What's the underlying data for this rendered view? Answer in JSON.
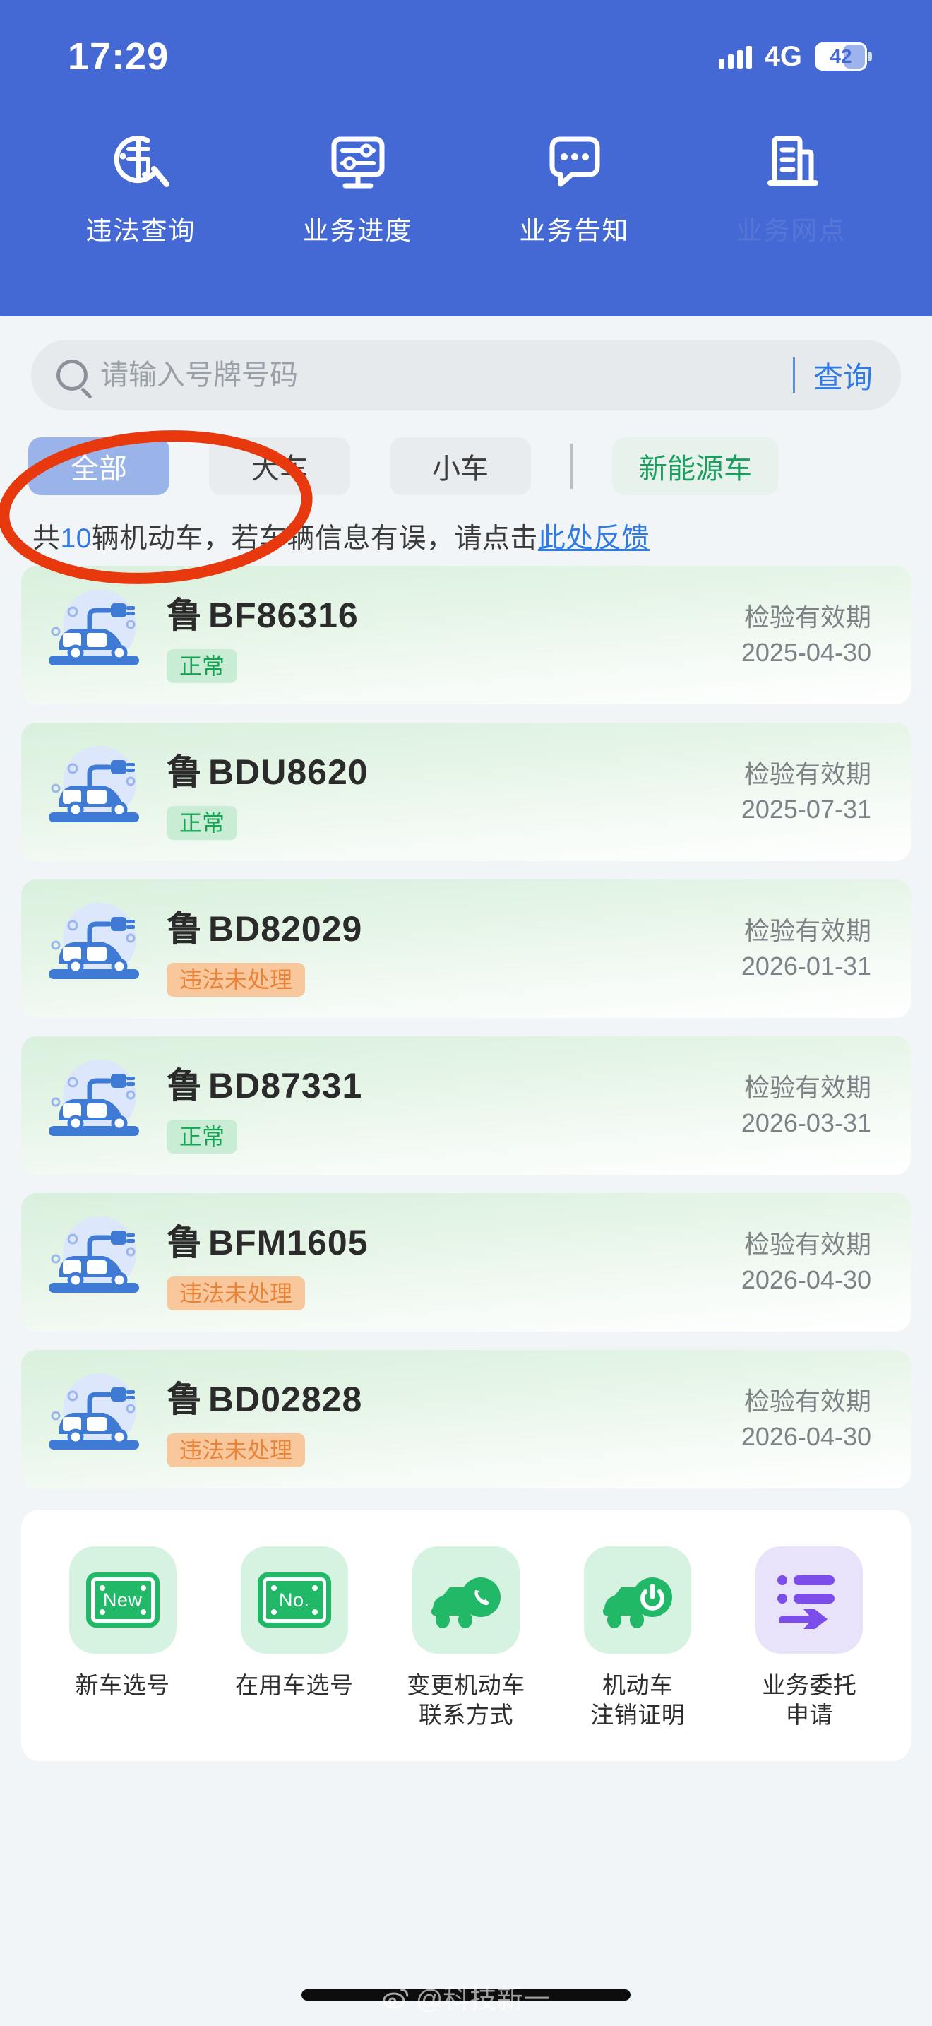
{
  "status_bar": {
    "time": "17:29",
    "network": "4G",
    "battery_percent": "42",
    "signal_icon": "signal-bars-icon",
    "battery_icon": "battery-icon"
  },
  "header": {
    "background_color": "#4569d4",
    "nav_items": [
      {
        "label": "违法查询",
        "icon": "violation-search-icon"
      },
      {
        "label": "业务进度",
        "icon": "business-progress-icon"
      },
      {
        "label": "业务告知",
        "icon": "business-notice-icon"
      },
      {
        "label": "业务网点",
        "icon": "office-building-icon"
      }
    ]
  },
  "search": {
    "placeholder": "请输入号牌号码",
    "value": "",
    "button_label": "查询",
    "icon": "search-icon"
  },
  "filters": {
    "chips": [
      {
        "label": "全部",
        "active": true,
        "style": "blue"
      },
      {
        "label": "大车",
        "active": false,
        "style": "grey"
      },
      {
        "label": "小车",
        "active": false,
        "style": "grey"
      },
      {
        "label": "新能源车",
        "active": false,
        "style": "green"
      }
    ]
  },
  "info": {
    "prefix": "共",
    "count": "10",
    "middle": "辆机动车，若车辆信息有误，请点击",
    "link": "此处反馈"
  },
  "vehicles": {
    "expiry_label": "检验有效期",
    "items": [
      {
        "province": "鲁",
        "plate": "BF86316",
        "status": "正常",
        "status_type": "ok",
        "expiry": "2025-04-30",
        "icon": "electric-car-icon"
      },
      {
        "province": "鲁",
        "plate": "BDU8620",
        "status": "正常",
        "status_type": "ok",
        "expiry": "2025-07-31",
        "icon": "electric-car-icon"
      },
      {
        "province": "鲁",
        "plate": "BD82029",
        "status": "违法未处理",
        "status_type": "warn",
        "expiry": "2026-01-31",
        "icon": "electric-car-icon"
      },
      {
        "province": "鲁",
        "plate": "BD87331",
        "status": "正常",
        "status_type": "ok",
        "expiry": "2026-03-31",
        "icon": "electric-car-icon"
      },
      {
        "province": "鲁",
        "plate": "BFM1605",
        "status": "违法未处理",
        "status_type": "warn",
        "expiry": "2026-04-30",
        "icon": "electric-car-icon"
      },
      {
        "province": "鲁",
        "plate": "BD02828",
        "status": "违法未处理",
        "status_type": "warn",
        "expiry": "2026-04-30",
        "icon": "electric-car-icon"
      }
    ]
  },
  "services": {
    "items": [
      {
        "label": "新车选号",
        "icon": "new-plate-icon",
        "glyph": "New",
        "color": "green"
      },
      {
        "label": "在用车选号",
        "icon": "existing-plate-icon",
        "glyph": "No.",
        "color": "green"
      },
      {
        "label": "变更机动车\n联系方式",
        "line1": "变更机动车",
        "line2": "联系方式",
        "icon": "car-phone-icon",
        "color": "green"
      },
      {
        "label": "机动车\n注销证明",
        "line1": "机动车",
        "line2": "注销证明",
        "icon": "car-deregister-icon",
        "color": "green"
      },
      {
        "label": "业务委托\n申请",
        "line1": "业务委托",
        "line2": "申请",
        "icon": "delegation-request-icon",
        "color": "purple"
      }
    ]
  },
  "footer": {
    "watermark": "@科技新一",
    "watermark_icon": "weibo-icon",
    "home_indicator": "home-indicator"
  },
  "annotation": {
    "type": "red-ellipse-highlight",
    "color": "#e8380d"
  },
  "colors": {
    "brand_blue": "#4569d4",
    "link_blue": "#2f7ae5",
    "status_ok": "#13a353",
    "status_warn": "#e8833a",
    "green_accent": "#21b867",
    "purple_accent": "#7c4dea",
    "page_bg": "#f2f5f7"
  }
}
